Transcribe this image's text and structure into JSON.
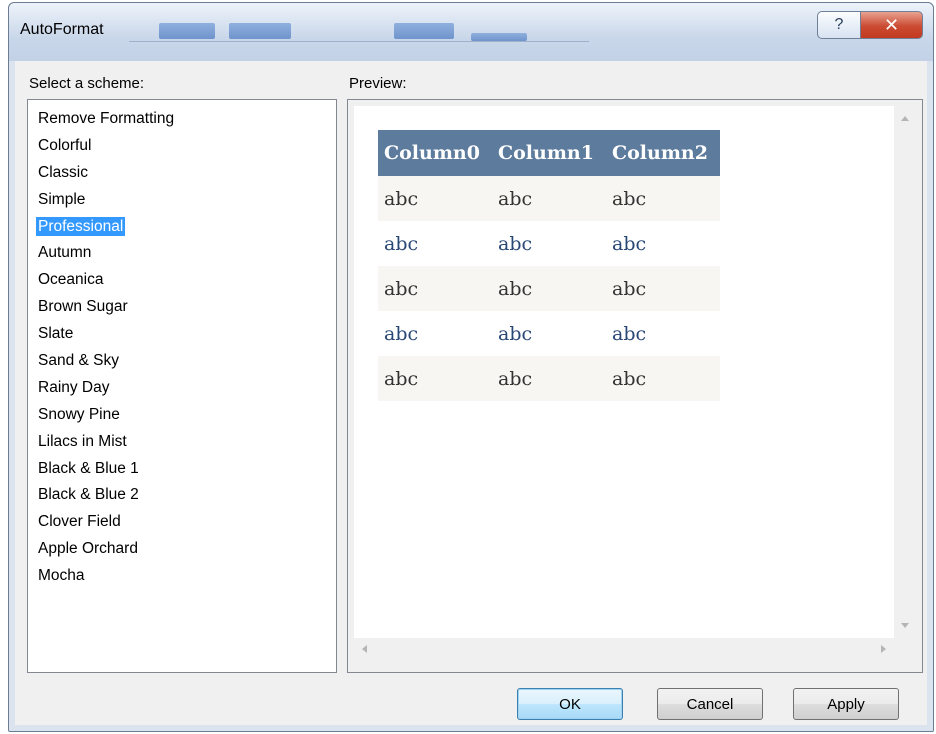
{
  "window": {
    "title": "AutoFormat",
    "help_glyph": "?",
    "close_glyph": "✕"
  },
  "labels": {
    "select_scheme": "Select a scheme:",
    "preview": "Preview:"
  },
  "schemes": [
    "Remove Formatting",
    "Colorful",
    "Classic",
    "Simple",
    "Professional",
    "Autumn",
    "Oceanica",
    "Brown Sugar",
    "Slate",
    "Sand & Sky",
    "Rainy Day",
    "Snowy Pine",
    "Lilacs in Mist",
    "Black & Blue 1",
    "Black & Blue 2",
    "Clover Field",
    "Apple Orchard",
    "Mocha"
  ],
  "selected_scheme": "Professional",
  "preview_table": {
    "headers": [
      "Column0",
      "Column1",
      "Column2"
    ],
    "rows": [
      [
        "abc",
        "abc",
        "abc"
      ],
      [
        "abc",
        "abc",
        "abc"
      ],
      [
        "abc",
        "abc",
        "abc"
      ],
      [
        "abc",
        "abc",
        "abc"
      ],
      [
        "abc",
        "abc",
        "abc"
      ]
    ]
  },
  "buttons": {
    "ok": "OK",
    "cancel": "Cancel",
    "apply": "Apply"
  },
  "colors": {
    "header_bg": "#5d7b9d",
    "selection": "#3399ff"
  }
}
